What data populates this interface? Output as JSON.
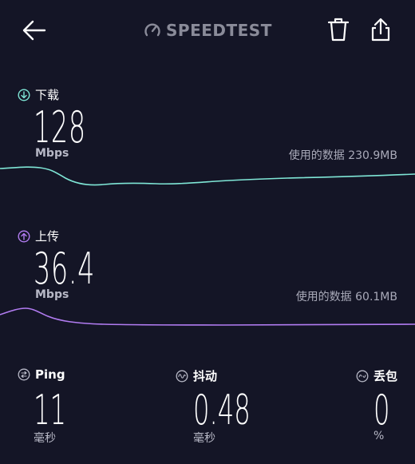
{
  "header": {
    "logo_text": "SPEEDTEST"
  },
  "download": {
    "label": "下载",
    "value": "128",
    "unit": "Mbps",
    "data_used": "使用的数据 230.9MB",
    "color": "#7fe6d6"
  },
  "upload": {
    "label": "上传",
    "value": "36.4",
    "unit": "Mbps",
    "data_used": "使用的数据 60.1MB",
    "color": "#b27cf2"
  },
  "stats": {
    "ping": {
      "label": "Ping",
      "value": "11",
      "unit": "毫秒"
    },
    "jitter": {
      "label": "抖动",
      "value": "0.48",
      "unit": "毫秒"
    },
    "loss": {
      "label": "丢包",
      "value": "0",
      "unit": "%"
    }
  }
}
